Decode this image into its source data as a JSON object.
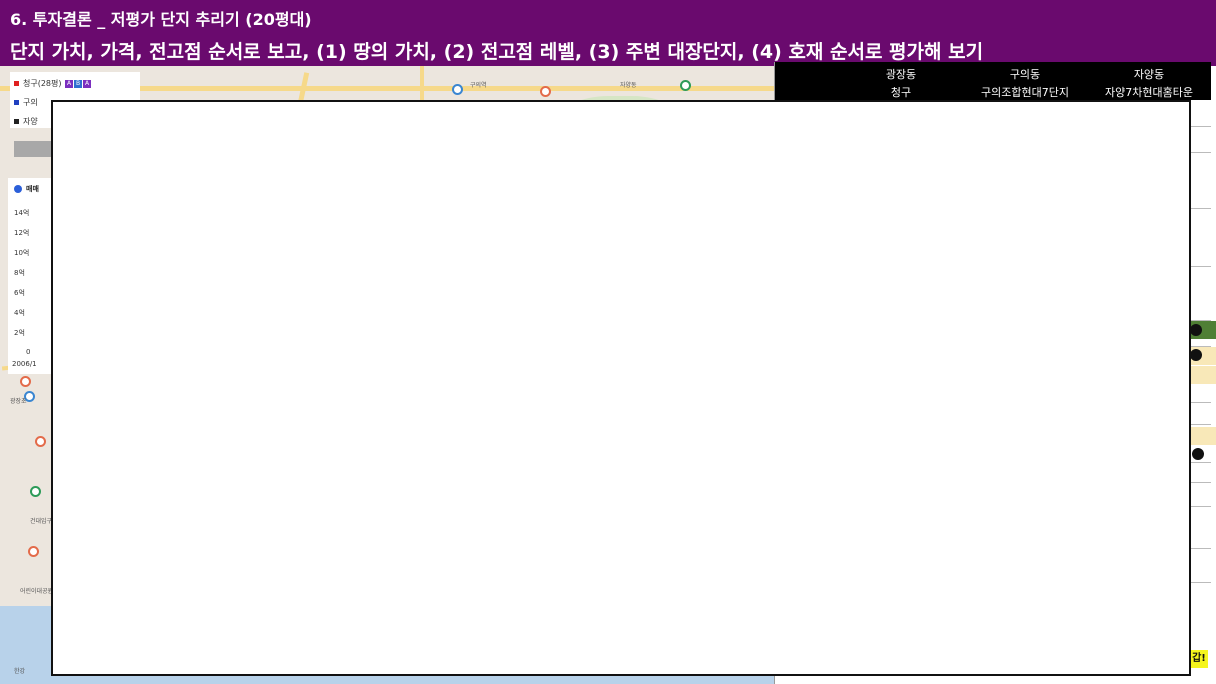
{
  "header": {
    "title": "6. 투자결론 _ 저평가 단지 추리기 (20평대)",
    "subtitle": "단지 가치, 가격, 전고점 순서로 보고, (1) 땅의 가치, (2) 전고점 레벨, (3) 주변 대장단지, (4) 호재 순서로 평가해 보기"
  },
  "table": {
    "columns": [
      {
        "dong": "광장동",
        "complex": "청구"
      },
      {
        "dong": "구의동",
        "complex": "구의조합현대7단지"
      },
      {
        "dong": "자양동",
        "complex": "자양7차현대홈타운"
      }
    ],
    "tag_text": "갑!"
  },
  "legend": {
    "items": [
      {
        "label": "청구(28평)",
        "color": "#e02020"
      },
      {
        "label": "구의",
        "color": "#2040c0"
      },
      {
        "label": "자양",
        "color": "#222222"
      }
    ],
    "badges": [
      "A",
      "B",
      "A"
    ]
  },
  "chart": {
    "mode_label": "매매",
    "y_ticks": [
      "14억",
      "12억",
      "10억",
      "8억",
      "6억",
      "4억",
      "2억",
      "0"
    ],
    "x_start": "2006/1"
  },
  "map": {
    "labels": [
      "광장초",
      "구의역",
      "자양동",
      "건대입구",
      "어린이대공원",
      "한강"
    ]
  },
  "colors": {
    "header_bg": "#6a0a6e",
    "table_header_bg": "#000000",
    "accent_green": "#4f7f35",
    "accent_yellow": "#f5f51e"
  }
}
